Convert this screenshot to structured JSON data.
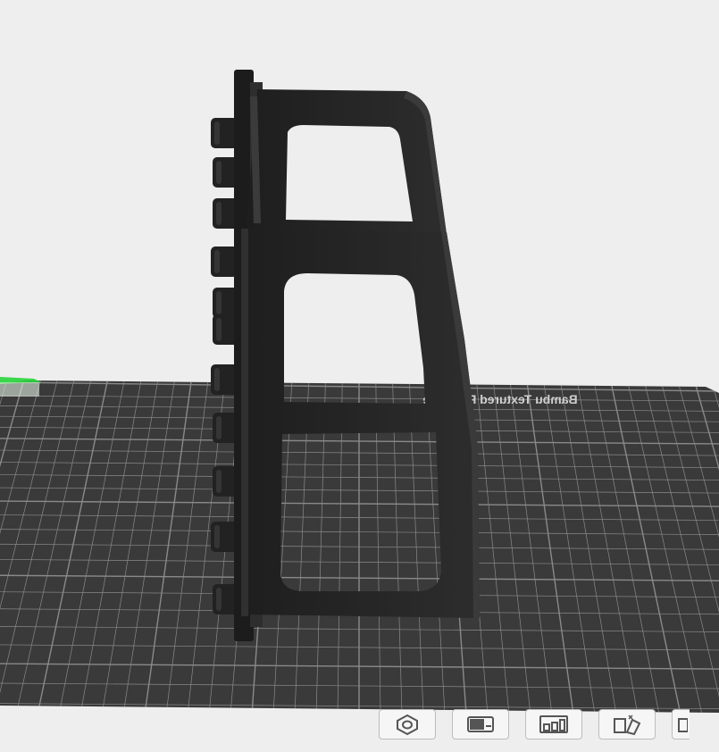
{
  "viewport": {
    "plate_label": "Bambu Textured PEI Plate",
    "colors": {
      "background": "#eeeeee",
      "plate": "#3a3a3a",
      "grid_line": "#8a8a8a",
      "model": "#262626",
      "model_highlight": "#3c3c3c",
      "axis": "#27d33a"
    }
  },
  "toolbar": {
    "buttons": [
      {
        "icon": "orient-icon",
        "name": "auto-orient-button"
      },
      {
        "icon": "arrange-icon",
        "name": "arrange-button"
      },
      {
        "icon": "layout-icon",
        "name": "layout-button"
      },
      {
        "icon": "split-icon",
        "name": "split-button"
      },
      {
        "icon": "more-icon",
        "name": "more-button"
      }
    ]
  }
}
